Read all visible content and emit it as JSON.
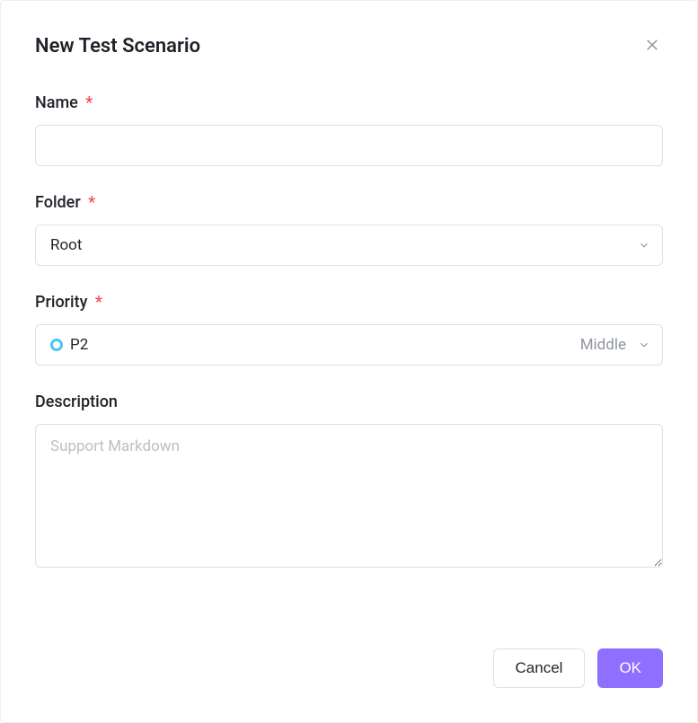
{
  "dialog": {
    "title": "New Test Scenario"
  },
  "fields": {
    "name": {
      "label": "Name",
      "required": "*",
      "value": ""
    },
    "folder": {
      "label": "Folder",
      "required": "*",
      "value": "Root"
    },
    "priority": {
      "label": "Priority",
      "required": "*",
      "value": "P2",
      "levelLabel": "Middle"
    },
    "description": {
      "label": "Description",
      "placeholder": "Support Markdown",
      "value": ""
    }
  },
  "buttons": {
    "cancel": "Cancel",
    "ok": "OK"
  }
}
